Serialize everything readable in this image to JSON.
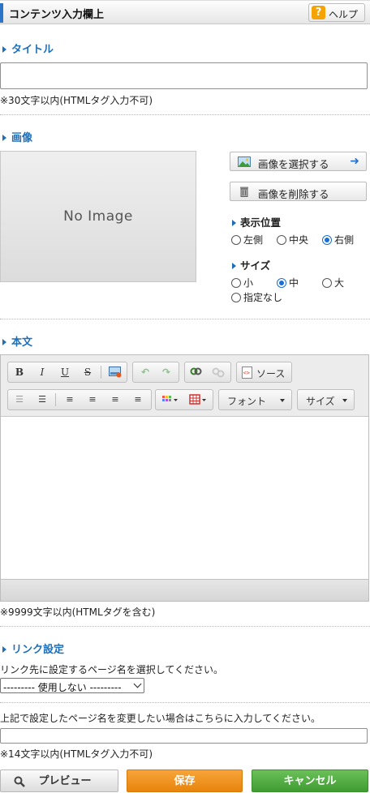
{
  "header": {
    "title": "コンテンツ入力欄上",
    "help_label": "ヘルプ",
    "help_icon": "?"
  },
  "title_section": {
    "heading": "タイトル",
    "value": "",
    "note": "※30文字以内(HTMLタグ入力不可)"
  },
  "image_section": {
    "heading": "画像",
    "placeholder_text": "No Image",
    "select_button": "画像を選択する",
    "delete_button": "画像を削除する",
    "position": {
      "heading": "表示位置",
      "options": [
        "左側",
        "中央",
        "右側"
      ],
      "selected": "右側"
    },
    "size": {
      "heading": "サイズ",
      "options": [
        "小",
        "中",
        "大",
        "指定なし"
      ],
      "selected": "中"
    }
  },
  "body_section": {
    "heading": "本文",
    "toolbar": {
      "bold": "B",
      "italic": "I",
      "underline": "U",
      "strike": "S",
      "source_label": "ソース",
      "font_label": "フォント",
      "size_label": "サイズ"
    },
    "content": "",
    "note": "※9999文字以内(HTMLタグを含む)"
  },
  "link_section": {
    "heading": "リンク設定",
    "instruction": "リンク先に設定するページ名を選択してください。",
    "select_value": "--------- 使用しない ---------",
    "rename_instruction": "上記で設定したページ名を変更したい場合はこちらに入力してください。",
    "rename_value": "",
    "rename_note": "※14文字以内(HTMLタグ入力不可)"
  },
  "footer": {
    "preview": "プレビュー",
    "save": "保存",
    "cancel": "キャンセル"
  },
  "colors": {
    "accent": "#1f6fb8",
    "save": "#f0921f",
    "cancel": "#52ab42"
  }
}
